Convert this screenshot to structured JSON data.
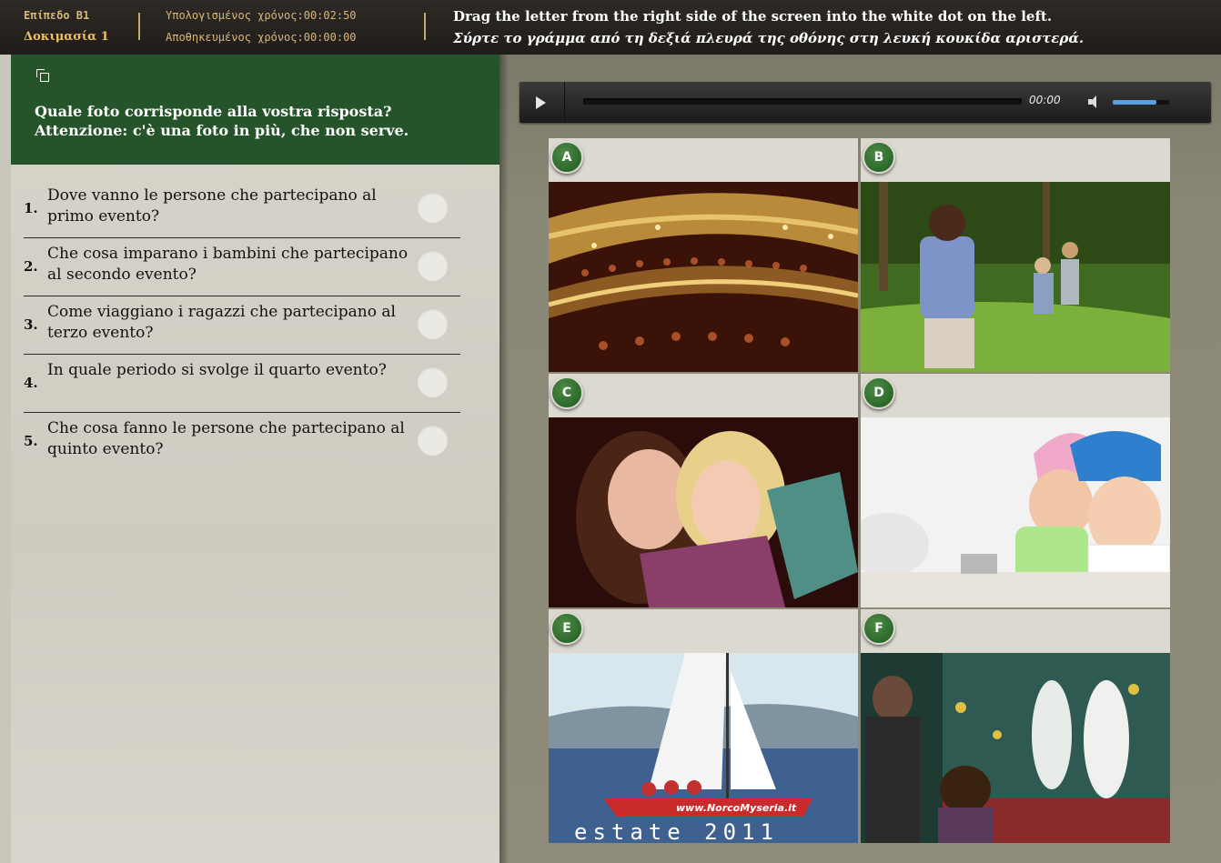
{
  "header": {
    "level": "Επίπεδο Β1",
    "test": "Δοκιμασία 1",
    "calculated_time": "Υπολογισμένος χρόνος:00:02:50",
    "saved_time": "Αποθηκευμένος χρόνος:00:00:00",
    "instruction_en": "Drag the letter from the right side of the screen into the white dot on the left.",
    "instruction_gr": "Σύρτε το γράμμα από τη δεξιά πλευρά της οθόνης στη λευκή κουκίδα αριστερά."
  },
  "prompt": {
    "line1": "Quale foto corrisponde alla vostra risposta?",
    "line2": "Attenzione: c'è una foto in più, che non serve."
  },
  "questions": [
    {
      "num": "1.",
      "text": "Dove vanno le persone che partecipano al primo evento?"
    },
    {
      "num": "2.",
      "text": "Che cosa imparano i bambini che partecipano al secondo evento?"
    },
    {
      "num": "3.",
      "text": "Come viaggiano i ragazzi che partecipano al terzo evento?"
    },
    {
      "num": "4.",
      "text": "In quale periodo si svolge il quarto evento?"
    },
    {
      "num": "5.",
      "text": "Che cosa fanno le persone che partecipano al quinto evento?"
    }
  ],
  "player": {
    "time": "00:00",
    "volume_fraction": 0.78
  },
  "options": [
    {
      "letter": "A",
      "scene": "theater-audience"
    },
    {
      "letter": "B",
      "scene": "children-walking-in-woods"
    },
    {
      "letter": "C",
      "scene": "mother-reading-with-child"
    },
    {
      "letter": "D",
      "scene": "children-cooking"
    },
    {
      "letter": "E",
      "scene": "sailboat",
      "photo_text_top": "www.NorcoMyseria.it",
      "photo_text_bottom": "estate 2011"
    },
    {
      "letter": "F",
      "scene": "children-at-aquarium-nativity"
    }
  ],
  "colors": {
    "header_bg": "#25542a",
    "badge": "#2f6b2b",
    "topbar": "#2a2622"
  }
}
